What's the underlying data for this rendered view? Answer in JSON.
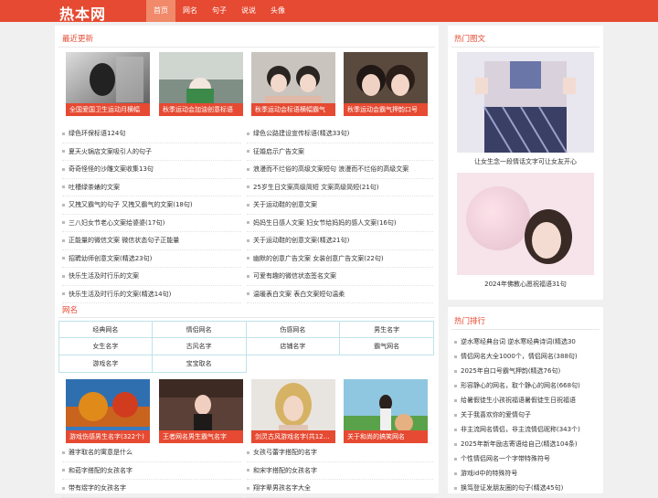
{
  "site": {
    "logo": "热本网"
  },
  "nav": {
    "items": [
      "首页",
      "网名",
      "句子",
      "说说",
      "头像"
    ]
  },
  "recent": {
    "title": "最近更新",
    "thumbs": [
      "全国爱国卫生运动月横幅",
      "秋季运动会加油创意标语",
      "秋季运动会标语横幅霸气",
      "秋季运动会霸气押韵口号"
    ],
    "left_list": [
      "绿色环保标语124句",
      "夏天火锅店文案吸引人的句子",
      "奇奇怪怪的沙雕文案收集13句",
      "吐槽绿茶婊的文案",
      "又拽又霸气的句子 又拽又霸气的文案(18句)",
      "三八妇女节老心文案给婆婆(17句)",
      "正能量的微信文案 微信状态句子正能量",
      "招聘幼师创意文案(精选23句)",
      "快乐生活及时行乐的文案",
      "快乐生活及时行乐的文案(精选14句)"
    ],
    "right_list": [
      "绿色公路建设宣传标语(精选33句)",
      "征婚启示广告文案",
      "浪漫而不烂俗的高级文案短句 浪漫而不烂俗的高级文案",
      "25岁生日文案高级简短 文案高级简短(21句)",
      "关于运动鞋的创意文案",
      "妈妈生日感人文案 妇女节给妈妈的感人文案(16句)",
      "关于运动鞋的创意文案(精选21句)",
      "幽默的创意广告文案 女装创意广告文案(22句)",
      "可爱有趣的微信状态签名文案",
      "温暖表白文案 表白文案短句温柔"
    ]
  },
  "names": {
    "title": "网名",
    "tags": [
      "经典网名",
      "情侣网名",
      "伤感网名",
      "男生名字",
      "女生名字",
      "古风名字",
      "店铺名字",
      "霸气网名",
      "游戏名字",
      "宝宝取名"
    ],
    "thumbs": [
      "游戏伤感男生名字(322个)",
      "王者网名男生霸气名字",
      "剑灵古风游戏名字(共12个)",
      "关于和尚的搞笑网名"
    ],
    "left_list": [
      "雅字取名的寓意是什么",
      "和茹字搭配的女孩名字",
      "带有煜字的女孩名字"
    ],
    "right_list": [
      "女孩弓蕾字搭配的名字",
      "和宋字搭配的女孩名字",
      "翔字辈男孩名字大全"
    ]
  },
  "hot_pics": {
    "title": "热门图文",
    "items": [
      "让女生念一段情话文字可让女友开心",
      "2024年佛教心愿祝福语31句"
    ]
  },
  "hot_rank": {
    "title": "热门排行",
    "items": [
      "逆水寒经典台词 逆水寒经典诗词(精选30",
      "情侣网名大全1000个，情侣网名(388句)",
      "2025年自口号霸气押韵(精选76句)",
      "形容静心的网名，取个静心的网名(668句)",
      "给暑假徒生小孩祝福语暑假徒生日祝福语",
      "关于我喜欢你的爱情句子",
      "非主流网名情侣，非主流情侣昵称(343个)",
      "2025年新年励志寄语给自己(精选104条)",
      "个性情侣网名一个字带特殊符号",
      "游戏id中的特殊符号",
      "换笃登证发朋友圈的句子(精选45句)"
    ]
  },
  "colors": {
    "brand": "#e64a32",
    "nav_active": "#f08a6a",
    "tag_border": "#bfe3ea"
  }
}
